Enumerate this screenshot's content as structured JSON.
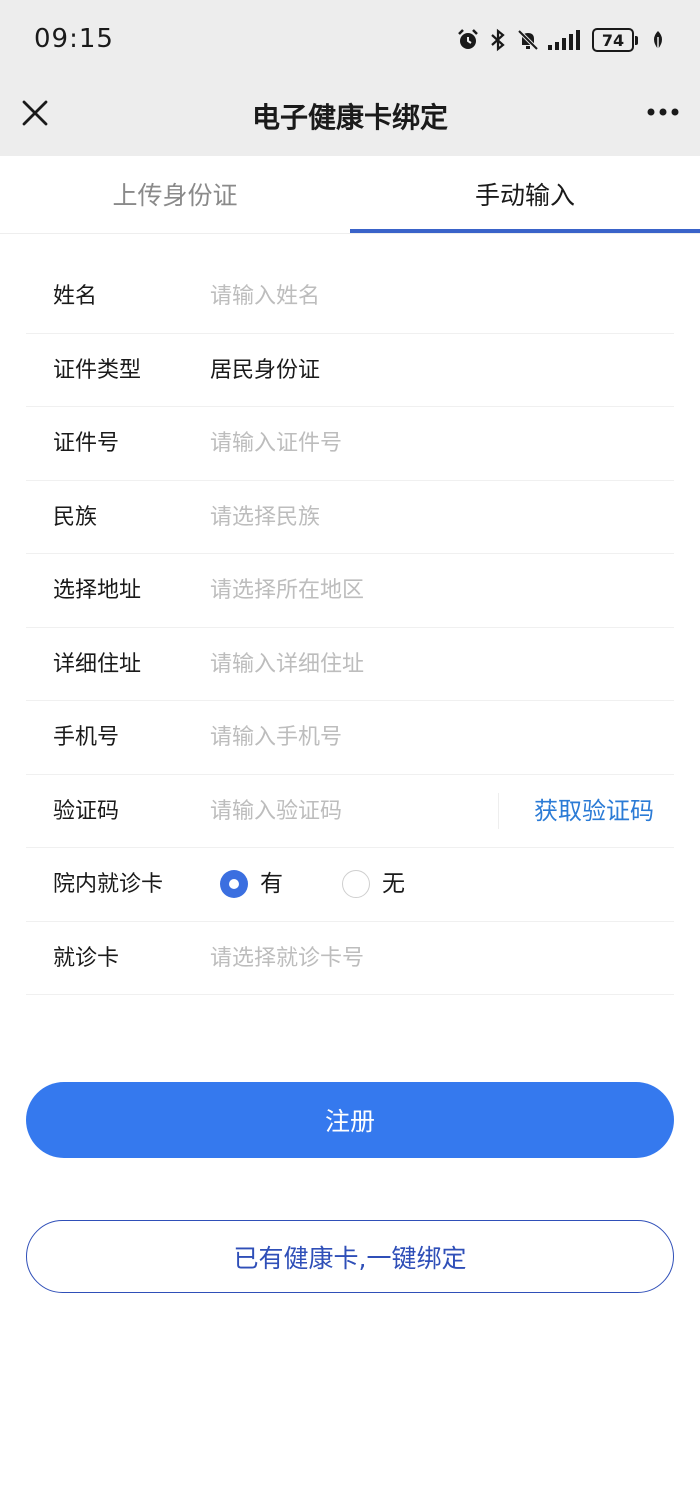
{
  "status_bar": {
    "time": "09:15",
    "battery": "74",
    "icons": [
      "alarm-icon",
      "bluetooth-icon",
      "mute-bell-icon",
      "signal-icon",
      "battery-icon",
      "leaf-icon"
    ]
  },
  "header": {
    "title": "电子健康卡绑定",
    "close_icon": "close-icon",
    "more_icon": "more-icon"
  },
  "tabs": [
    {
      "label": "上传身份证",
      "active": false
    },
    {
      "label": "手动输入",
      "active": true
    }
  ],
  "form": {
    "name": {
      "label": "姓名",
      "placeholder": "请输入姓名"
    },
    "id_type": {
      "label": "证件类型",
      "value": "居民身份证"
    },
    "id_number": {
      "label": "证件号",
      "placeholder": "请输入证件号"
    },
    "ethnicity": {
      "label": "民族",
      "placeholder": "请选择民族"
    },
    "region": {
      "label": "选择地址",
      "placeholder": "请选择所在地区"
    },
    "address": {
      "label": "详细住址",
      "placeholder": "请输入详细住址"
    },
    "phone": {
      "label": "手机号",
      "placeholder": "请输入手机号"
    },
    "verify_code": {
      "label": "验证码",
      "placeholder": "请输入验证码",
      "action": "获取验证码"
    },
    "hospital_card": {
      "label": "院内就诊卡",
      "options": [
        "有",
        "无"
      ],
      "selected": "有"
    },
    "card": {
      "label": "就诊卡",
      "placeholder": "请选择就诊卡号"
    }
  },
  "buttons": {
    "register": "注册",
    "bind": "已有健康卡,一键绑定"
  },
  "colors": {
    "accent": "#3579ee",
    "tab_indicator": "#3a63c9",
    "link": "#2b7bd6",
    "bind_border": "#2f4fb8",
    "placeholder": "#bdbdbd"
  }
}
